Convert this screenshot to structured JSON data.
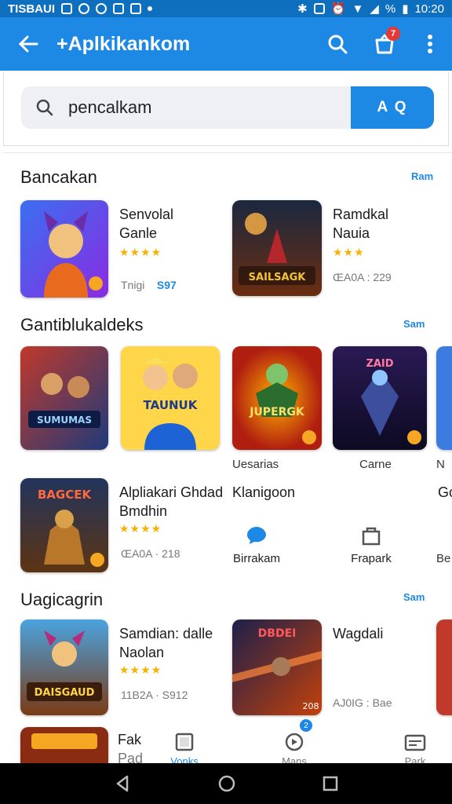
{
  "status_bar": {
    "left_text": "TISBAUI",
    "time": "10:20",
    "battery_text": "%"
  },
  "app_bar": {
    "title": "+Aplkikankom",
    "notification_count": "7"
  },
  "search": {
    "value": "pencalkam",
    "button_label": "A Q"
  },
  "sections": [
    {
      "title": "Bancakan",
      "link": "Ram",
      "items": [
        {
          "name_line1": "Senvolal",
          "name_line2": "Ganle",
          "stars": "★★★★",
          "meta_left": "Tnigi",
          "meta_right": "S97"
        },
        {
          "name_line1": "Ramdkal",
          "name_line2": "Nauia",
          "stars": "★★★",
          "meta_left": "ŒA0A : 229",
          "meta_right": ""
        }
      ],
      "thumb_titles": [
        "",
        "SAILSAGK"
      ]
    },
    {
      "title": "Gantiblukaldeks",
      "link": "Sam",
      "grid_titles": [
        "SUMUMAS",
        "TAUNUK",
        "JUPERGK",
        "ZAID"
      ],
      "grid_captions": [
        "",
        "",
        "Uesarias",
        "Carne",
        "N"
      ],
      "feature": {
        "thumb_title": "BAGCEK",
        "line1": "Alpliakari Ghdad",
        "line2": "Bmdhin",
        "stars": "★★★★",
        "meta": "ŒA0A · 218"
      },
      "quick_title": "Klanigoon",
      "quick_actions": [
        "Birrakam",
        "Frapark"
      ],
      "edge_captions": [
        "Go",
        "Be"
      ]
    },
    {
      "title": "Uagicagrin",
      "link": "Sam",
      "items": [
        {
          "thumb_title": "DAISGAUD",
          "name_line1": "Samdian: dalle",
          "name_line2": "Naolan",
          "stars": "★★★★",
          "meta": "11B2A · S912"
        },
        {
          "thumb_title": "DBDEI",
          "name_line1": "Wagdali",
          "meta": "AJ0IG : Bae",
          "corner": "208"
        }
      ]
    }
  ],
  "partial_item": {
    "line1": "Fak",
    "line2": "Pad"
  },
  "bottom_nav": {
    "tabs": [
      "Vonks",
      "Mans",
      "Park"
    ],
    "badge": "2"
  },
  "colors": {
    "primary": "#1e88e5",
    "status": "#0f6fbf",
    "star": "#f5b301"
  }
}
